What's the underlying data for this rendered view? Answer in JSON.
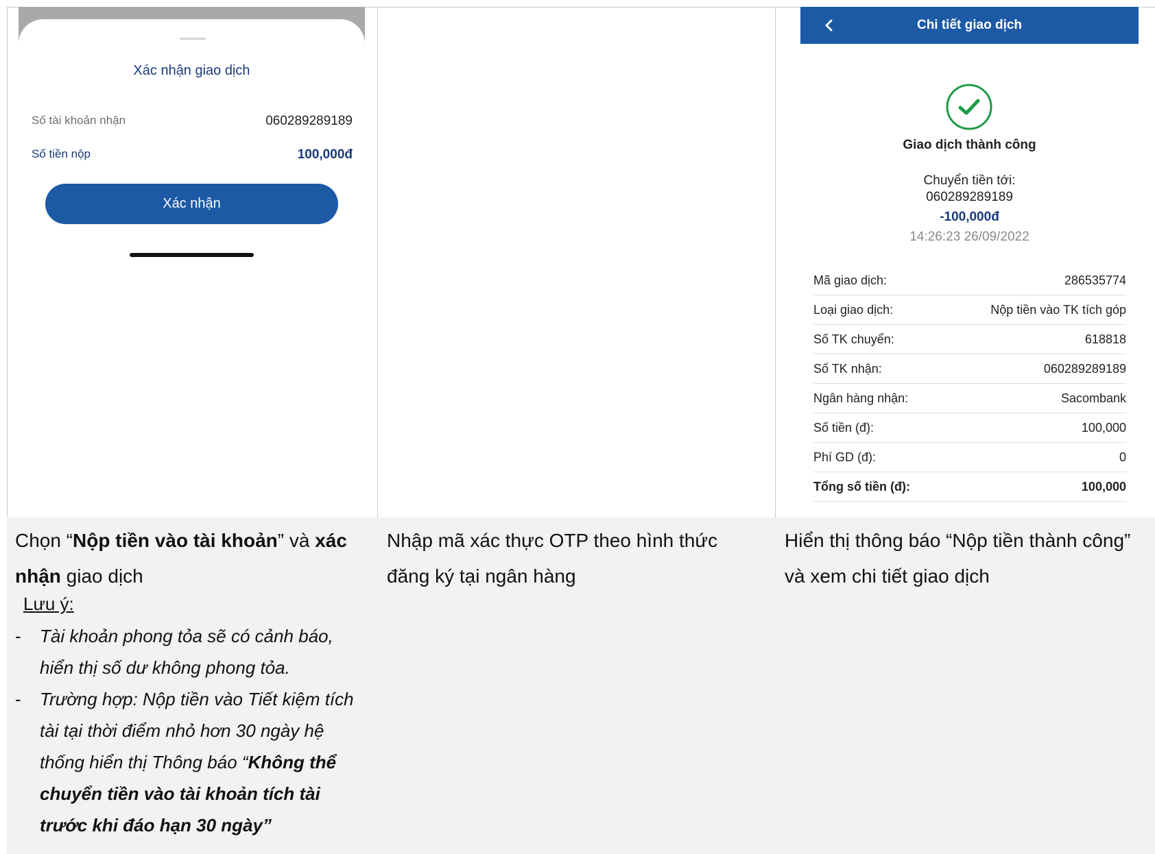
{
  "confirm_screen": {
    "title": "Xác nhận giao dịch",
    "rows": [
      {
        "label": "Số tài khoản nhận",
        "value": "060289289189"
      },
      {
        "label": "Số tiền nộp",
        "value": "100,000đ"
      }
    ],
    "confirm_label": "Xác nhận"
  },
  "detail_screen": {
    "title": "Chi tiết giao dịch",
    "status": "Giao dịch thành công",
    "transfer_to_label": "Chuyển tiền tới:",
    "transfer_to_account": "060289289189",
    "amount": "-100,000đ",
    "datetime": "14:26:23 26/09/2022",
    "rows": [
      {
        "label": "Mã giao dịch:",
        "value": "286535774"
      },
      {
        "label": "Loại giao dịch:",
        "value": "Nộp tiền vào TK tích góp"
      },
      {
        "label": "Số TK chuyển:",
        "value": "618818"
      },
      {
        "label": "Số TK nhận:",
        "value": "060289289189"
      },
      {
        "label": "Ngân hàng nhận:",
        "value": "Sacombank"
      },
      {
        "label": "Số tiền (đ):",
        "value": "100,000"
      },
      {
        "label": "Phí GD (đ):",
        "value": "0"
      },
      {
        "label": "Tổng số tiền (đ):",
        "value": "100,000"
      }
    ],
    "colors": {
      "primary": "#1d5aa6",
      "success": "#1e9b45",
      "heading": "#1a3b7a"
    }
  },
  "descriptions": {
    "col1": {
      "p1": "Chọn “",
      "b1": "Nộp tiền vào tài khoản",
      "p2": "” và ",
      "b2": "xác nhận",
      "p3": " giao dịch",
      "note_title": "Lưu ý:",
      "note1": "Tài khoản phong tỏa sẽ có cảnh báo, hiển thị số dư không phong tỏa.",
      "note2_prefix": "Trường hợp: Nộp tiền vào Tiết kiệm tích tài tại thời điểm nhỏ hơn 30 ngày hệ thống hiển thị Thông báo “",
      "note2_bold": "Không thể chuyển tiền vào tài khoản tích tài trước khi đáo hạn 30 ngày”"
    },
    "col2": "Nhập mã xác thực OTP theo hình thức đăng ký tại ngân hàng",
    "col3": "Hiển thị thông báo “Nộp tiền thành công” và xem chi tiết giao dịch"
  }
}
